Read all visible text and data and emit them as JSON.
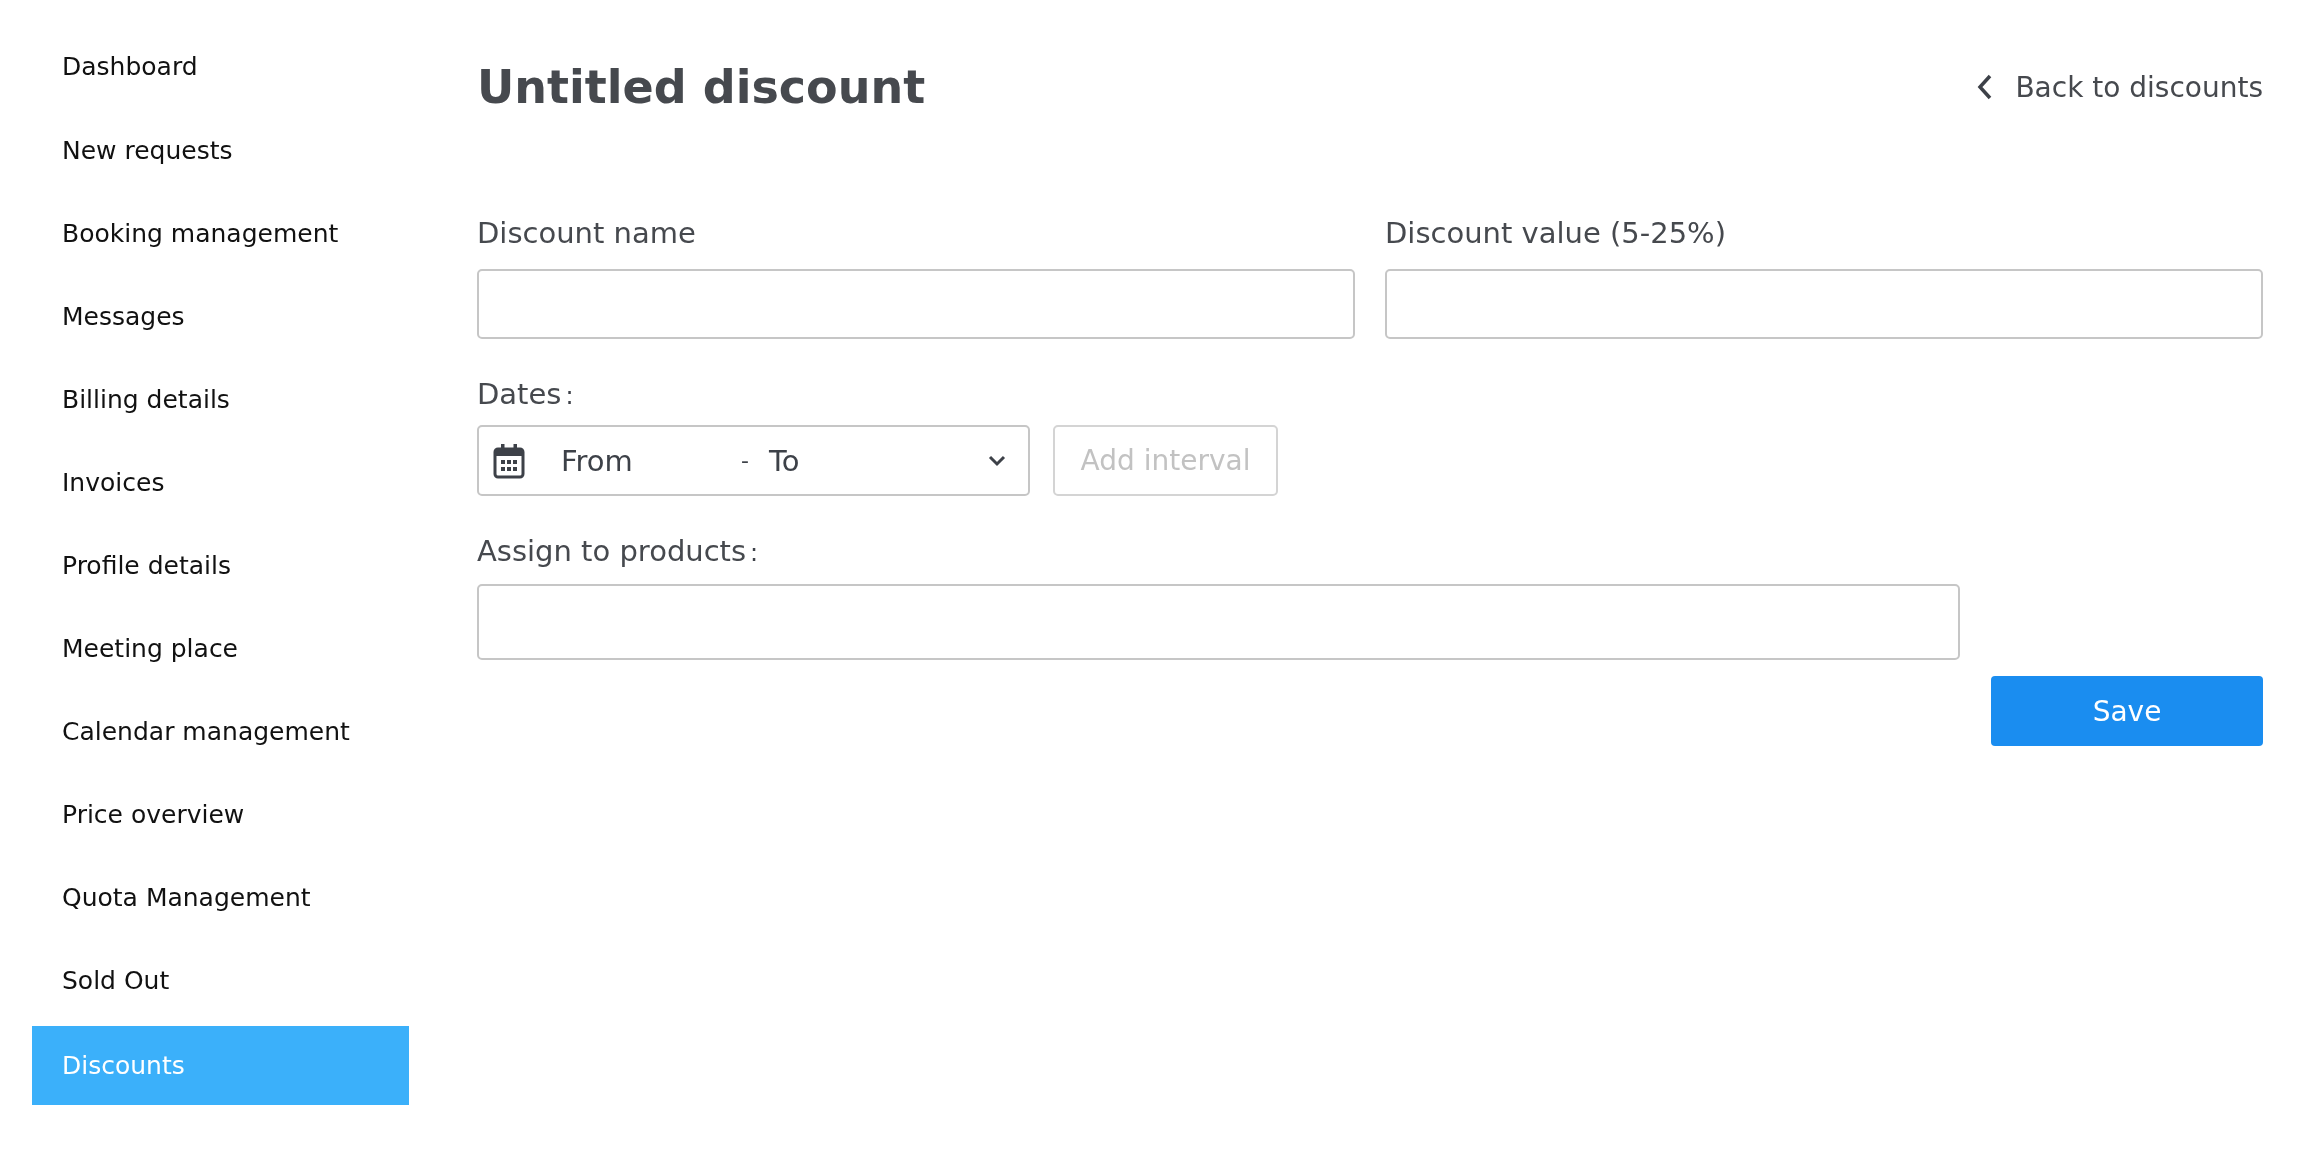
{
  "sidebar": {
    "items": [
      {
        "label": "Dashboard",
        "selected": false
      },
      {
        "label": "New requests",
        "selected": false
      },
      {
        "label": "Booking management",
        "selected": false
      },
      {
        "label": "Messages",
        "selected": false
      },
      {
        "label": "Billing details",
        "selected": false
      },
      {
        "label": "Invoices",
        "selected": false
      },
      {
        "label": "Profile details",
        "selected": false
      },
      {
        "label": "Meeting place",
        "selected": false
      },
      {
        "label": "Calendar management",
        "selected": false
      },
      {
        "label": "Price overview",
        "selected": false
      },
      {
        "label": "Quota Management",
        "selected": false
      },
      {
        "label": "Sold Out",
        "selected": false
      },
      {
        "label": "Discounts",
        "selected": true
      }
    ]
  },
  "header": {
    "title": "Untitled discount",
    "back_link": "Back to discounts"
  },
  "form": {
    "discount_name": {
      "label": "Discount name"
    },
    "discount_value": {
      "label": "Discount value (5-25%)"
    },
    "dates": {
      "label": "Dates",
      "colon": ":",
      "from": {
        "placeholder": "From"
      },
      "separator": "-",
      "to": {
        "placeholder": "To"
      },
      "add_interval": {
        "label": "Add interval",
        "disabled": true
      }
    },
    "products": {
      "label": "Assign to products",
      "colon": ":"
    },
    "save_button": "Save"
  }
}
